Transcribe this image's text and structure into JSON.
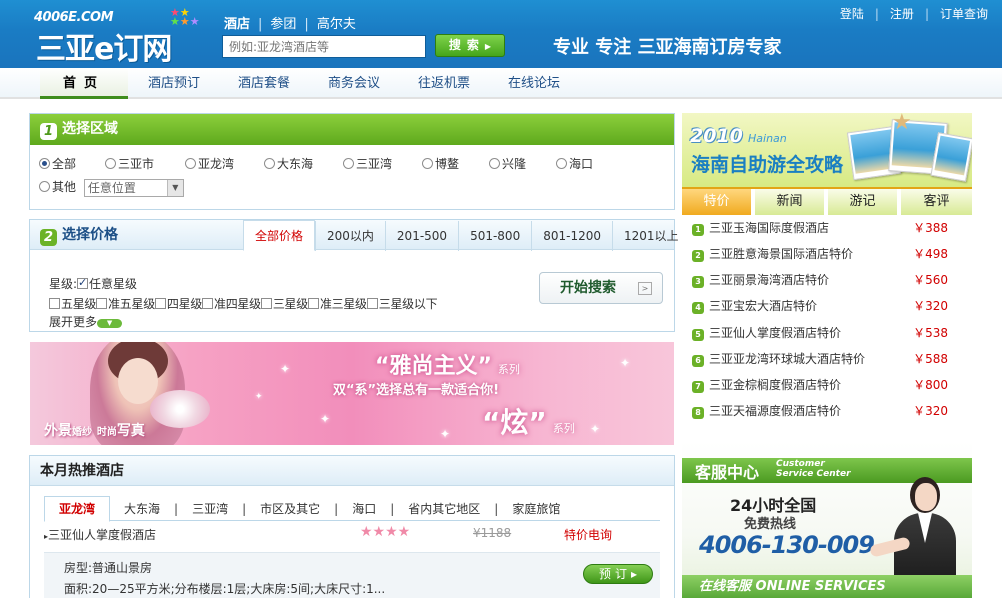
{
  "header": {
    "logo_top": "4006E.COM",
    "logo_main": "三亚e订网",
    "search_tabs": [
      "酒店",
      "参团",
      "高尔夫"
    ],
    "search_placeholder": "例如:亚龙湾酒店等",
    "search_button": "搜索",
    "slogan": "专业 专注 三亚海南订房专家",
    "top_links": [
      "登陆",
      "注册",
      "订单查询"
    ]
  },
  "nav": {
    "items": [
      "首页",
      "酒店预订",
      "酒店套餐",
      "商务会议",
      "往返机票",
      "在线论坛"
    ]
  },
  "area": {
    "step": "1",
    "title": "选择区域",
    "options": [
      "全部",
      "三亚市",
      "亚龙湾",
      "大东海",
      "三亚湾",
      "博鳌",
      "兴隆",
      "海口"
    ],
    "other_label": "其他",
    "other_select": "任意位置"
  },
  "price": {
    "step": "2",
    "title": "选择价格",
    "tabs": [
      "全部价格",
      "200以内",
      "201-500",
      "501-800",
      "801-1200",
      "1201以上"
    ],
    "star_label": "星级:",
    "star_any": "任意星级",
    "stars": [
      "五星级",
      "准五星级",
      "四星级",
      "准四星级",
      "三星级",
      "准三星级",
      "三星级以下"
    ],
    "expand": "展开更多",
    "expand_icon": "▼",
    "search_button": "开始搜索",
    "search_button_icon": ">"
  },
  "banner": {
    "tagline_a": "外景",
    "tagline_b": "婚纱",
    "tagline_c": "时尚",
    "tagline_d": "写真",
    "line1": "“雅尚主义”",
    "line1_suffix": "系列",
    "line2": "双“系”选择总有一款适合你!",
    "line3": "“炫”",
    "line3_suffix": "系列"
  },
  "hot": {
    "title": "本月热推酒店",
    "tabs": [
      "亚龙湾",
      "大东海",
      "三亚湾",
      "市区及其它",
      "海口",
      "省内其它地区",
      "家庭旅馆"
    ],
    "hotel_name": "三亚仙人掌度假酒店",
    "hotel_stars": "★★★★",
    "hotel_original_price": "¥1188",
    "hotel_price": "特价电询",
    "room_label": "房型:",
    "room_type": "普通山景房",
    "detail": "面积:20—25平方米;分布楼层:1层;大床房:5间;大床尺寸:1...",
    "book_button": "预订",
    "book_icon": "▸"
  },
  "guide_ad": {
    "year": "2010",
    "year_en": "Hainan",
    "title": "海南自助游全攻略"
  },
  "news": {
    "tabs": [
      "特价",
      "新闻",
      "游记",
      "客评"
    ]
  },
  "ranking": [
    {
      "num": "1",
      "name": "三亚玉海国际度假酒店",
      "price": "￥388"
    },
    {
      "num": "2",
      "name": "三亚胜意海景国际酒店特价",
      "price": "￥498"
    },
    {
      "num": "3",
      "name": "三亚丽景海湾酒店特价",
      "price": "￥560"
    },
    {
      "num": "4",
      "name": "三亚宝宏大酒店特价",
      "price": "￥320"
    },
    {
      "num": "5",
      "name": "三亚仙人掌度假酒店特价",
      "price": "￥538"
    },
    {
      "num": "6",
      "name": "三亚亚龙湾环球城大酒店特价",
      "price": "￥588"
    },
    {
      "num": "7",
      "name": "三亚金棕榈度假酒店特价",
      "price": "￥800"
    },
    {
      "num": "8",
      "name": "三亚天福源度假酒店特价",
      "price": "￥320"
    }
  ],
  "service": {
    "title": "客服中心",
    "title_en_1": "Customer",
    "title_en_2": "Service Center",
    "hours": "24小时全国",
    "free_line": "免费热线",
    "phone": "4006-130-009",
    "online": "在线客服 ONLINE SERVICES"
  },
  "colors": {
    "header_blue": "#1a7cc4",
    "green": "#5ea91d",
    "price_red": "#d10000",
    "tab_orange": "#f0aa1f"
  }
}
